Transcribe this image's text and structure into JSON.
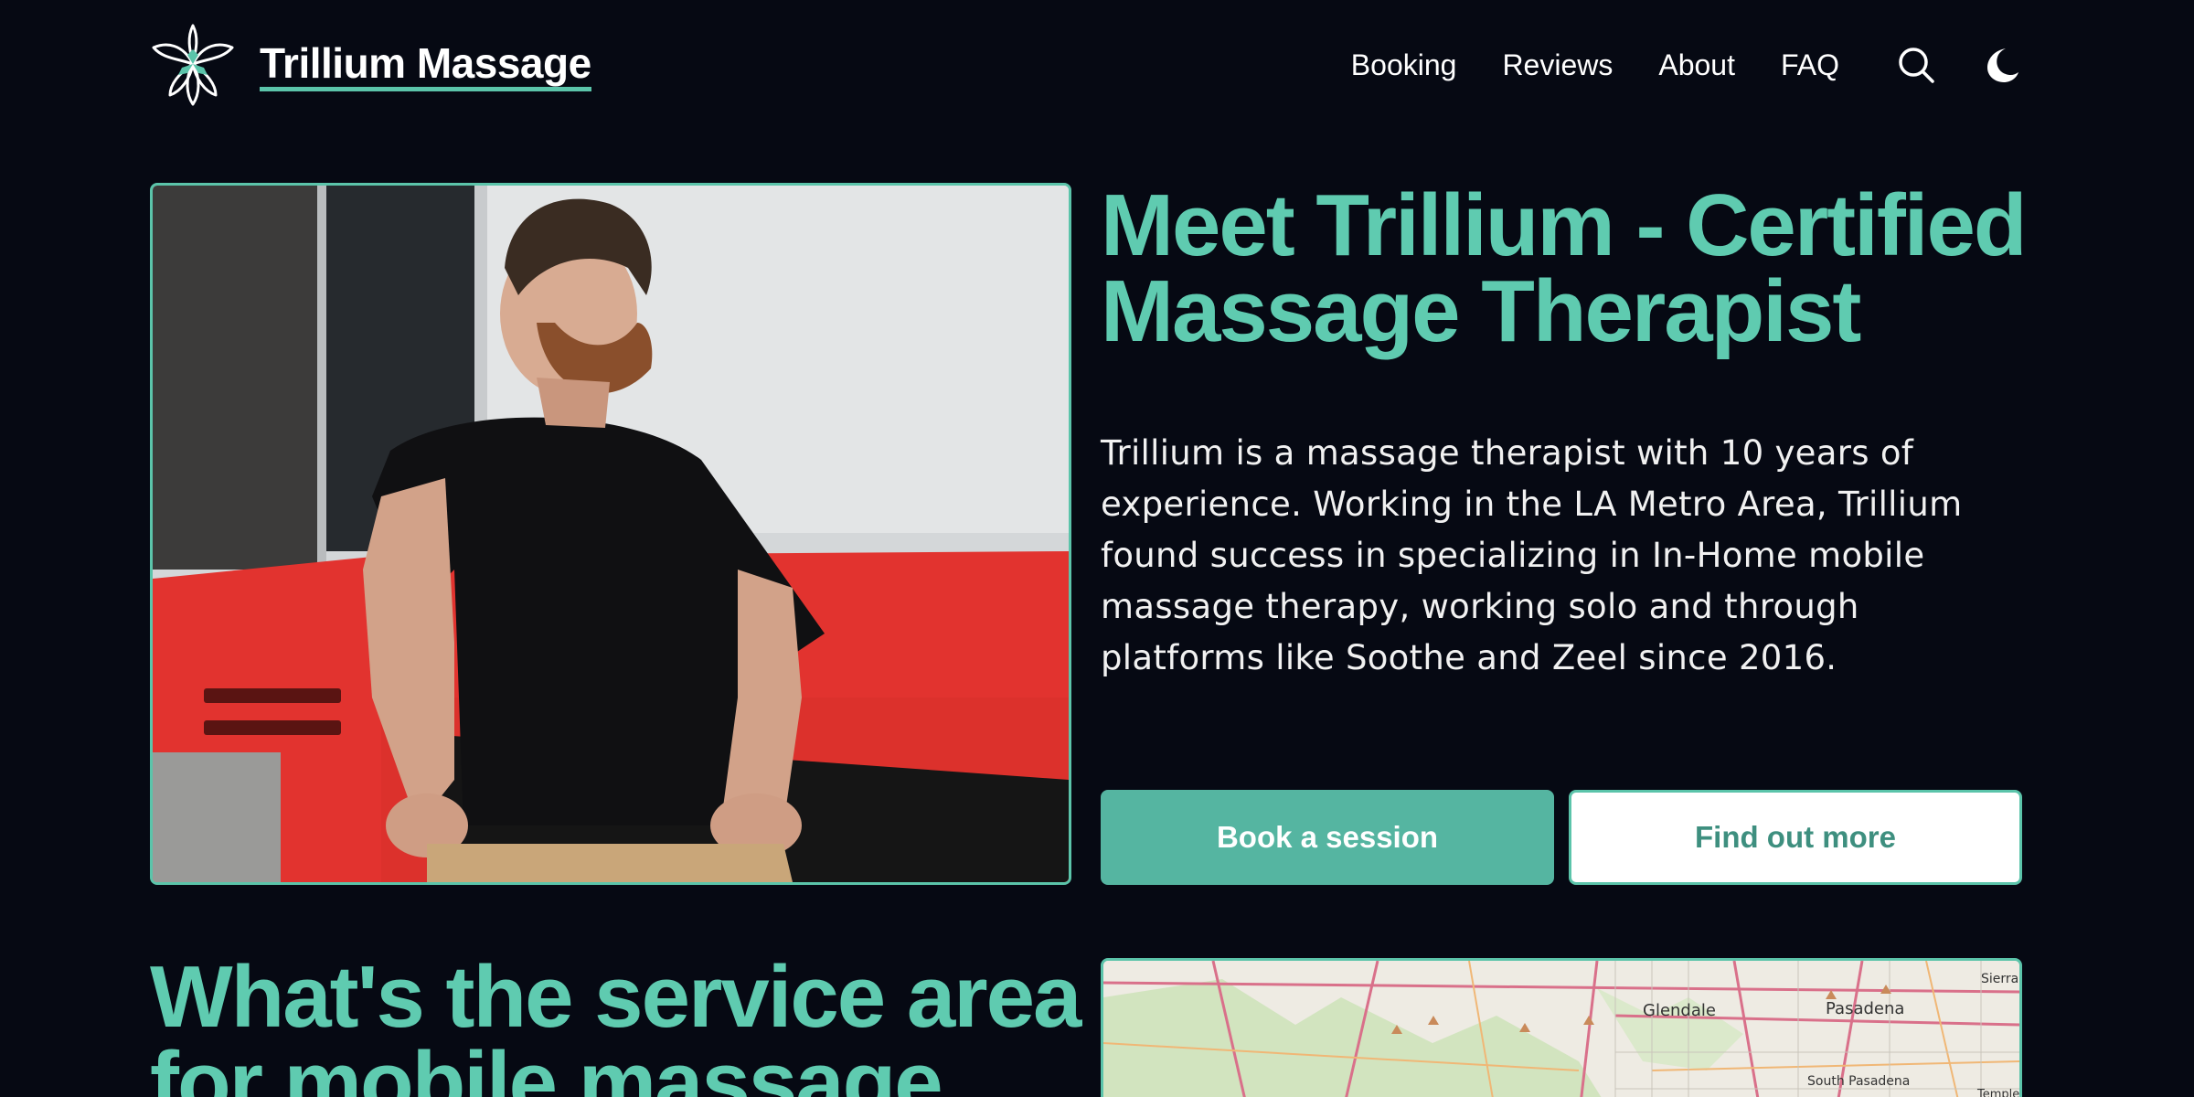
{
  "header": {
    "brand": "Trillium Massage",
    "logo_icon": "trillium-flower-icon",
    "nav": [
      "Booking",
      "Reviews",
      "About",
      "FAQ"
    ],
    "search_icon": "search-icon",
    "theme_icon": "moon-icon"
  },
  "hero": {
    "title": "Meet Trillium - Certified Massage Therapist",
    "description": "Trillium is a massage therapist with 10 years of experience. Working in the LA Metro Area, Trillium found success in specializing in In-Home mobile massage therapy, working solo and through platforms like Soothe and Zeel since 2016.",
    "photo_icon": "therapist-photo",
    "primary_button": "Book a session",
    "secondary_button": "Find out more"
  },
  "service_area": {
    "title": "What's the service area for mobile massage",
    "map": {
      "places": [
        "Glendale",
        "Pasadena",
        "South Pasadena",
        "Sierra",
        "Temple"
      ]
    }
  },
  "colors": {
    "background": "#060913",
    "accent": "#5fcbb0",
    "button_primary": "#55b5a1",
    "button_secondary_text": "#3e8f7f"
  }
}
